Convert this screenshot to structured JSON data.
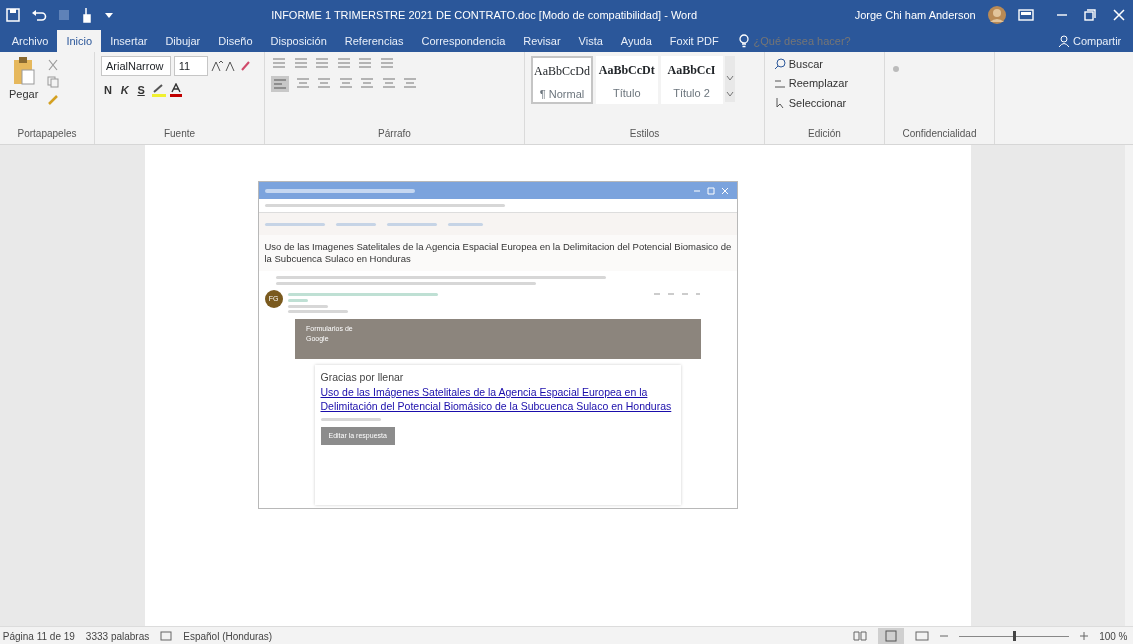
{
  "window": {
    "title": "INFORME 1 TRIMERSTRE 2021 DE CONTRATO.doc [Modo de compatibilidad] - Word",
    "user": "Jorge Chi ham Anderson"
  },
  "ribbon_tabs": [
    {
      "label": "Archivo",
      "selected": false
    },
    {
      "label": "Inicio",
      "selected": true
    },
    {
      "label": "Insertar",
      "selected": false
    },
    {
      "label": "Dibujar",
      "selected": false
    },
    {
      "label": "Diseño",
      "selected": false
    },
    {
      "label": "Disposición",
      "selected": false
    },
    {
      "label": "Referencias",
      "selected": false
    },
    {
      "label": "Correspondencia",
      "selected": false
    },
    {
      "label": "Revisar",
      "selected": false
    },
    {
      "label": "Vista",
      "selected": false
    },
    {
      "label": "Ayuda",
      "selected": false
    },
    {
      "label": "Foxit PDF",
      "selected": false
    }
  ],
  "tell_me": {
    "placeholder": "¿Qué desea hacer?"
  },
  "share_button": "Compartir",
  "clipboard": {
    "paste": "Pegar",
    "label": "Portapapeles"
  },
  "font": {
    "name": "ArialNarrow",
    "size": "11",
    "format_buttons": [
      "N",
      "K",
      "S"
    ],
    "label": "Fuente"
  },
  "paragraph": {
    "label": "Párrafo"
  },
  "styles": {
    "label": "Estilos",
    "items": [
      {
        "preview": "AaBbCcDd",
        "name": "¶ Normal",
        "selected": true
      },
      {
        "preview": "AaBbCcDt",
        "name": "Título",
        "selected": false
      },
      {
        "preview": "AaBbCcI",
        "name": "Título 2",
        "selected": false
      }
    ]
  },
  "editing": {
    "label": "Edición",
    "items": [
      "Buscar",
      "Reemplazar",
      "Seleccionar"
    ]
  },
  "confidentiality": {
    "label": "Confidencialidad"
  },
  "embedded_screenshot": {
    "subject": "Uso de las Imagenes Satelitales de la Agencia Espacial Europea en la Delimitacion del Potencial Biomasico de la Subcuenca Sulaco en Honduras",
    "sender_initials": "FG",
    "banner": "Formularios de Google",
    "thanks_prefix": "Gracias por llenar",
    "form_link": "Uso de las Imágenes Satelitales de la Agencia Espacial Europea en la Delimitación del Potencial Biomásico de la Subcuenca Sulaco en Honduras",
    "edit_button": "Editar la respuesta"
  },
  "status_bar": {
    "page": "Página 11 de 19",
    "words": "3333 palabras",
    "language": "Español (Honduras)",
    "zoom": "100 %",
    "zoom_slider": {
      "level": 0.5
    }
  }
}
